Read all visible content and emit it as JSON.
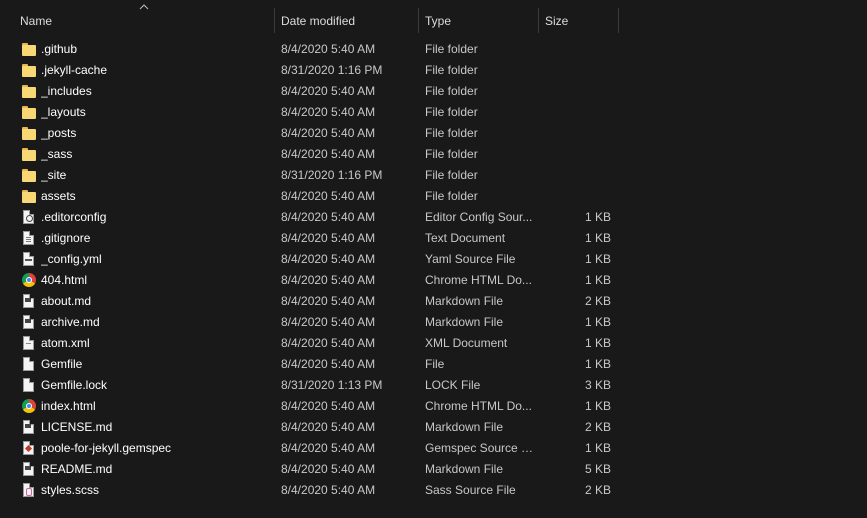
{
  "columns": {
    "name": "Name",
    "date": "Date modified",
    "type": "Type",
    "size": "Size"
  },
  "files": [
    {
      "name": ".github",
      "date": "8/4/2020 5:40 AM",
      "type": "File folder",
      "size": "",
      "icon": "folder"
    },
    {
      "name": ".jekyll-cache",
      "date": "8/31/2020 1:16 PM",
      "type": "File folder",
      "size": "",
      "icon": "folder"
    },
    {
      "name": "_includes",
      "date": "8/4/2020 5:40 AM",
      "type": "File folder",
      "size": "",
      "icon": "folder"
    },
    {
      "name": "_layouts",
      "date": "8/4/2020 5:40 AM",
      "type": "File folder",
      "size": "",
      "icon": "folder"
    },
    {
      "name": "_posts",
      "date": "8/4/2020 5:40 AM",
      "type": "File folder",
      "size": "",
      "icon": "folder"
    },
    {
      "name": "_sass",
      "date": "8/4/2020 5:40 AM",
      "type": "File folder",
      "size": "",
      "icon": "folder"
    },
    {
      "name": "_site",
      "date": "8/31/2020 1:16 PM",
      "type": "File folder",
      "size": "",
      "icon": "folder"
    },
    {
      "name": "assets",
      "date": "8/4/2020 5:40 AM",
      "type": "File folder",
      "size": "",
      "icon": "folder"
    },
    {
      "name": ".editorconfig",
      "date": "8/4/2020 5:40 AM",
      "type": "Editor Config Sour...",
      "size": "1 KB",
      "icon": "config"
    },
    {
      "name": ".gitignore",
      "date": "8/4/2020 5:40 AM",
      "type": "Text Document",
      "size": "1 KB",
      "icon": "text"
    },
    {
      "name": "_config.yml",
      "date": "8/4/2020 5:40 AM",
      "type": "Yaml Source File",
      "size": "1 KB",
      "icon": "yaml"
    },
    {
      "name": "404.html",
      "date": "8/4/2020 5:40 AM",
      "type": "Chrome HTML Do...",
      "size": "1 KB",
      "icon": "chrome"
    },
    {
      "name": "about.md",
      "date": "8/4/2020 5:40 AM",
      "type": "Markdown File",
      "size": "2 KB",
      "icon": "md"
    },
    {
      "name": "archive.md",
      "date": "8/4/2020 5:40 AM",
      "type": "Markdown File",
      "size": "1 KB",
      "icon": "md"
    },
    {
      "name": "atom.xml",
      "date": "8/4/2020 5:40 AM",
      "type": "XML Document",
      "size": "1 KB",
      "icon": "xml"
    },
    {
      "name": "Gemfile",
      "date": "8/4/2020 5:40 AM",
      "type": "File",
      "size": "1 KB",
      "icon": "blank"
    },
    {
      "name": "Gemfile.lock",
      "date": "8/31/2020 1:13 PM",
      "type": "LOCK File",
      "size": "3 KB",
      "icon": "blank"
    },
    {
      "name": "index.html",
      "date": "8/4/2020 5:40 AM",
      "type": "Chrome HTML Do...",
      "size": "1 KB",
      "icon": "chrome"
    },
    {
      "name": "LICENSE.md",
      "date": "8/4/2020 5:40 AM",
      "type": "Markdown File",
      "size": "2 KB",
      "icon": "md"
    },
    {
      "name": "poole-for-jekyll.gemspec",
      "date": "8/4/2020 5:40 AM",
      "type": "Gemspec Source F...",
      "size": "1 KB",
      "icon": "gem"
    },
    {
      "name": "README.md",
      "date": "8/4/2020 5:40 AM",
      "type": "Markdown File",
      "size": "5 KB",
      "icon": "md"
    },
    {
      "name": "styles.scss",
      "date": "8/4/2020 5:40 AM",
      "type": "Sass Source File",
      "size": "2 KB",
      "icon": "sass"
    }
  ]
}
